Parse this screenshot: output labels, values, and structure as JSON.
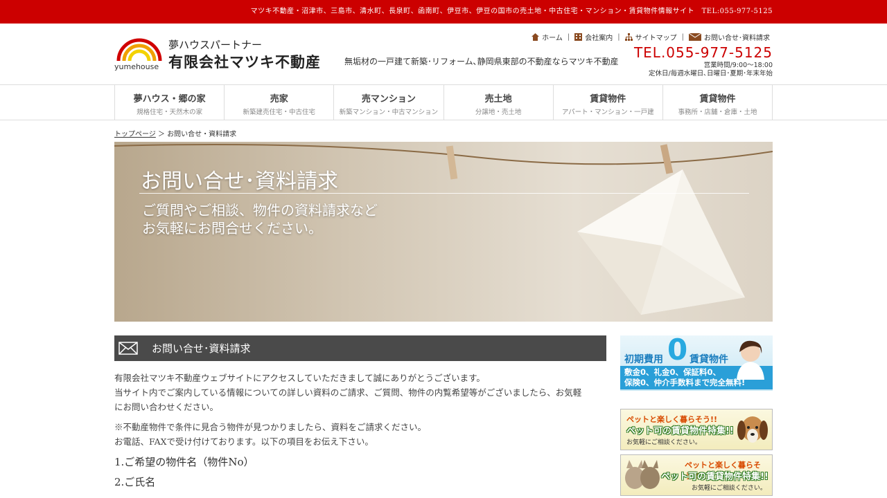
{
  "topbar": {
    "text": "マツキ不動産・沼津市、三島市、清水町、長泉町、函南町、伊豆市、伊豆の国市の売土地・中古住宅・マンション・賃貸物件情報サイト　TEL:055-977-5125"
  },
  "logo": {
    "brand": "yumehouse",
    "line1": "夢ハウスパートナー",
    "line2": "有限会社マツキ不動産"
  },
  "tagline": "無垢材の一戸建て新築･リフォーム､静岡県東部の不動産ならマツキ不動産",
  "util_nav": {
    "home": "ホーム",
    "company": "会社案内",
    "sitemap": "サイトマップ",
    "contact": "お問い合せ･資料請求",
    "separator": "|"
  },
  "tel": "TEL.055-977-5125",
  "hours": {
    "line1": "営業時間/9:00～18:00",
    "line2": "定休日/毎週水曜日､日曜日･夏期･年末年始"
  },
  "gnav": [
    {
      "main": "夢ハウス・郷の家",
      "sub": "規格住宅・天然木の家"
    },
    {
      "main": "売家",
      "sub": "新築建売住宅・中古住宅"
    },
    {
      "main": "売マンション",
      "sub": "新築マンション・中古マンション"
    },
    {
      "main": "売土地",
      "sub": "分譲地・売土地"
    },
    {
      "main": "賃貸物件",
      "sub": "アパート・マンション・一戸建"
    },
    {
      "main": "賃貸物件",
      "sub": "事務所・店舗・倉庫・土地"
    }
  ],
  "breadcrumb": {
    "home": "トップページ",
    "sep": "＞",
    "current": "お問い合せ・資料請求"
  },
  "hero": {
    "title": "お問い合せ･資料請求",
    "sub1": "ご質問やご相談、物件の資料請求など",
    "sub2": "お気軽にお問合せください。"
  },
  "section": {
    "heading": "お問い合せ･資料請求",
    "p1_l1": "有限会社マツキ不動産ウェブサイトにアクセスしていただきまして誠にありがとうございます。",
    "p1_l2": "当サイト内でご案内している情報についての詳しい資料のご請求、ご質問、物件の内覧希望等がございましたら、お気軽",
    "p1_l3": "にお問い合わせください。",
    "p2_l1": "※不動産物件で条件に見合う物件が見つかりましたら、資料をご請求ください。",
    "p2_l2": "お電話、FAXで受け付けております。以下の項目をお伝え下さい。",
    "items": [
      "1.ご希望の物件名（物件No）",
      "2.ご氏名"
    ]
  },
  "sidebar": {
    "banner1": {
      "a": "初期費用",
      "zero": "0",
      "b": "賃貸物件",
      "c1": "敷金0、礼金0、保証料0、",
      "c2": "保険0、仲介手数料まで完全無料!"
    },
    "banner2": {
      "a": "ペットと楽しく暮らそう!!",
      "b": "ペット可の賃貸物件特集!!",
      "c": "お気軽にご相談ください。"
    },
    "banner3": {
      "a": "ペットと楽しく暮らそう!!",
      "b": "ペット可の賃貸物件特集!!",
      "c": "お気軽にご相談ください。"
    }
  },
  "colors": {
    "brand_red": "#cc0000",
    "section_bg": "#4a4a4a",
    "accent_blue": "#28a9e0"
  }
}
